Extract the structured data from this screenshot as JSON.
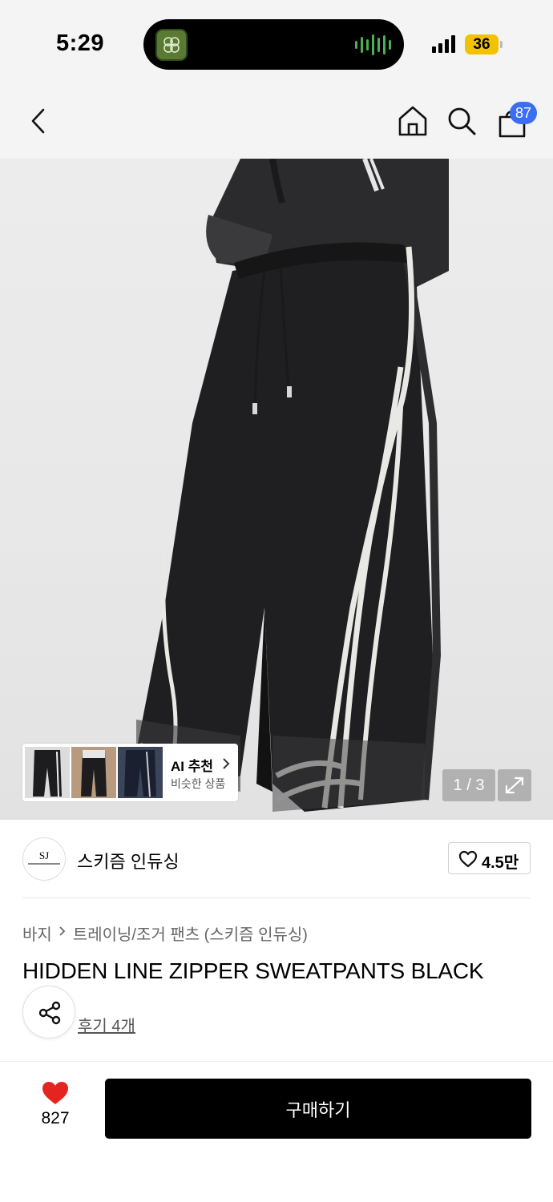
{
  "status_bar": {
    "time": "5:29",
    "battery": "36",
    "battery_color": "#f2c200",
    "island_wave_color": "#4caf50"
  },
  "nav": {
    "back_icon": "chevron-left-icon",
    "home_icon": "home-icon",
    "search_icon": "search-icon",
    "cart_icon": "shopping-bag-icon",
    "cart_count": "87",
    "badge_color": "#3b6ef5"
  },
  "gallery": {
    "counter": "1 / 3",
    "current_image": 1,
    "total_images": 3,
    "expand_icon": "expand-icon"
  },
  "ai_recommend": {
    "title": "AI 추천",
    "subtitle": "비슷한 상품"
  },
  "brand": {
    "name": "스키즘 인듀싱",
    "logo_text": "SJ",
    "likes": "4.5만"
  },
  "product": {
    "breadcrumb": [
      "바지",
      "트레이닝/조거 팬츠 (스키즘 인듀싱)"
    ],
    "title": "HIDDEN LINE ZIPPER SWEATPANTS BLACK",
    "reviews": "후기 4개"
  },
  "bottom_bar": {
    "wish_count": "827",
    "wish_color": "#e52420",
    "buy_label": "구매하기"
  }
}
